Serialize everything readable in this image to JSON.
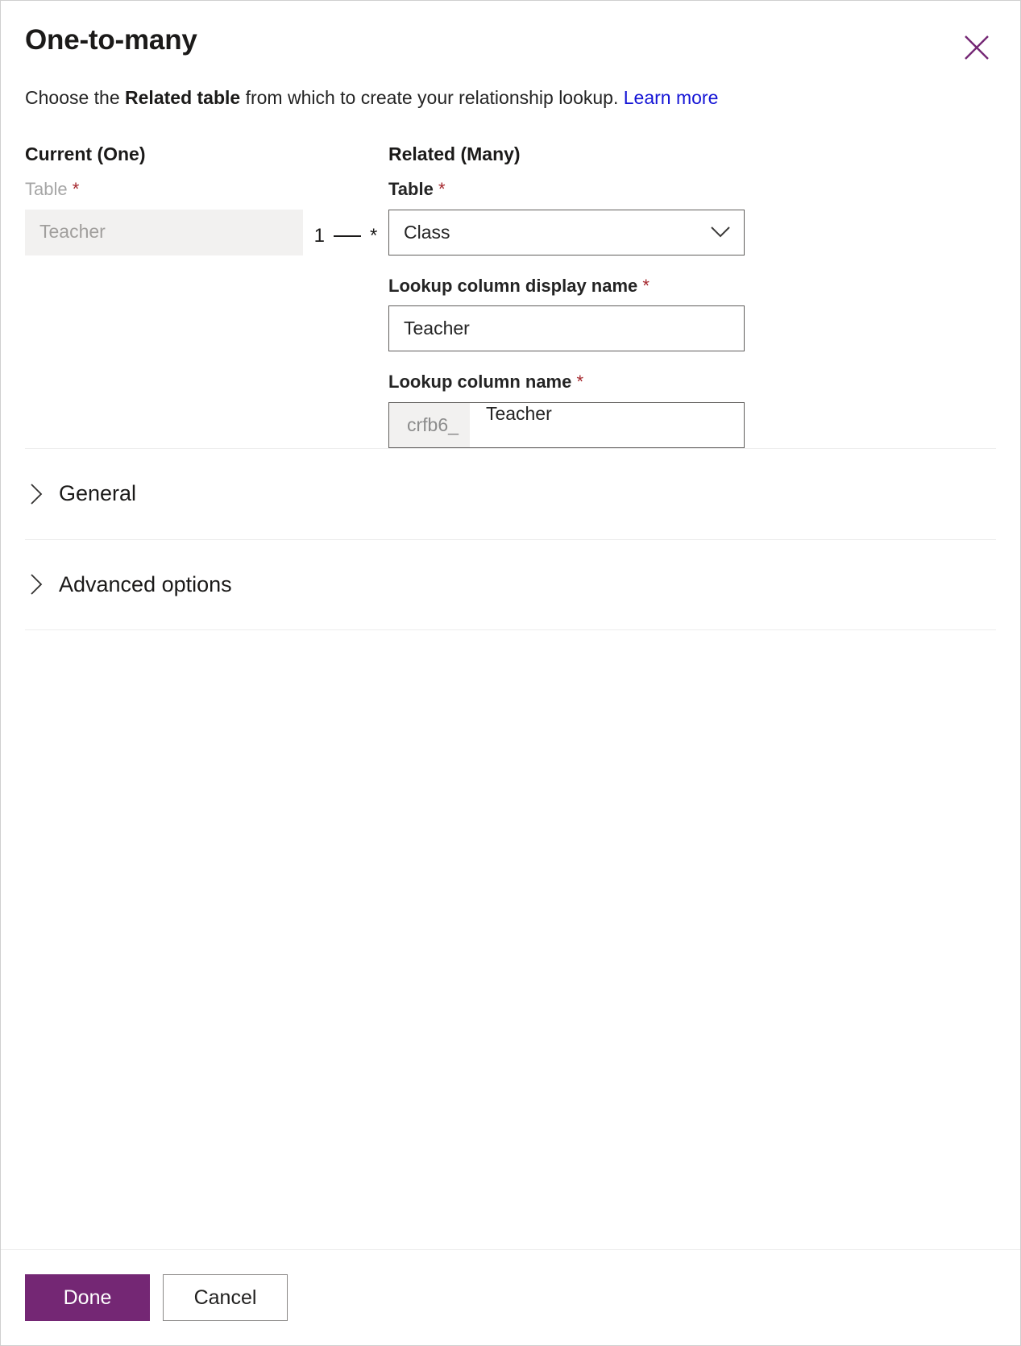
{
  "dialog": {
    "title": "One-to-many",
    "close_icon_label": "Close",
    "accent_color": "#742774",
    "link_color": "#1414d6",
    "close_icon_color": "#742774"
  },
  "subtitle": {
    "prefix": "Choose the ",
    "emphasis": "Related table",
    "suffix": " from which to create your relationship lookup. ",
    "link": "Learn more"
  },
  "current": {
    "heading": "Current (One)",
    "table_label": "Table ",
    "table_required": "*",
    "table_value": "Teacher"
  },
  "cardinality": {
    "one": "1",
    "many": "*"
  },
  "related": {
    "heading": "Related (Many)",
    "table_label": "Table ",
    "table_required": "*",
    "table_value": "Class",
    "table_chevron_icon": "chevron-down-icon",
    "lookup_display_label": "Lookup column display name ",
    "lookup_display_required": "*",
    "lookup_display_value": "Teacher",
    "lookup_name_label": "Lookup column name ",
    "lookup_name_required": "*",
    "lookup_name_prefix": "crfb6_",
    "lookup_name_value": "Teacher"
  },
  "sections": [
    {
      "label": "General",
      "icon": "chevron-right-icon",
      "expanded": false
    },
    {
      "label": "Advanced options",
      "icon": "chevron-right-icon",
      "expanded": false
    }
  ],
  "footer": {
    "done_label": "Done",
    "cancel_label": "Cancel"
  }
}
